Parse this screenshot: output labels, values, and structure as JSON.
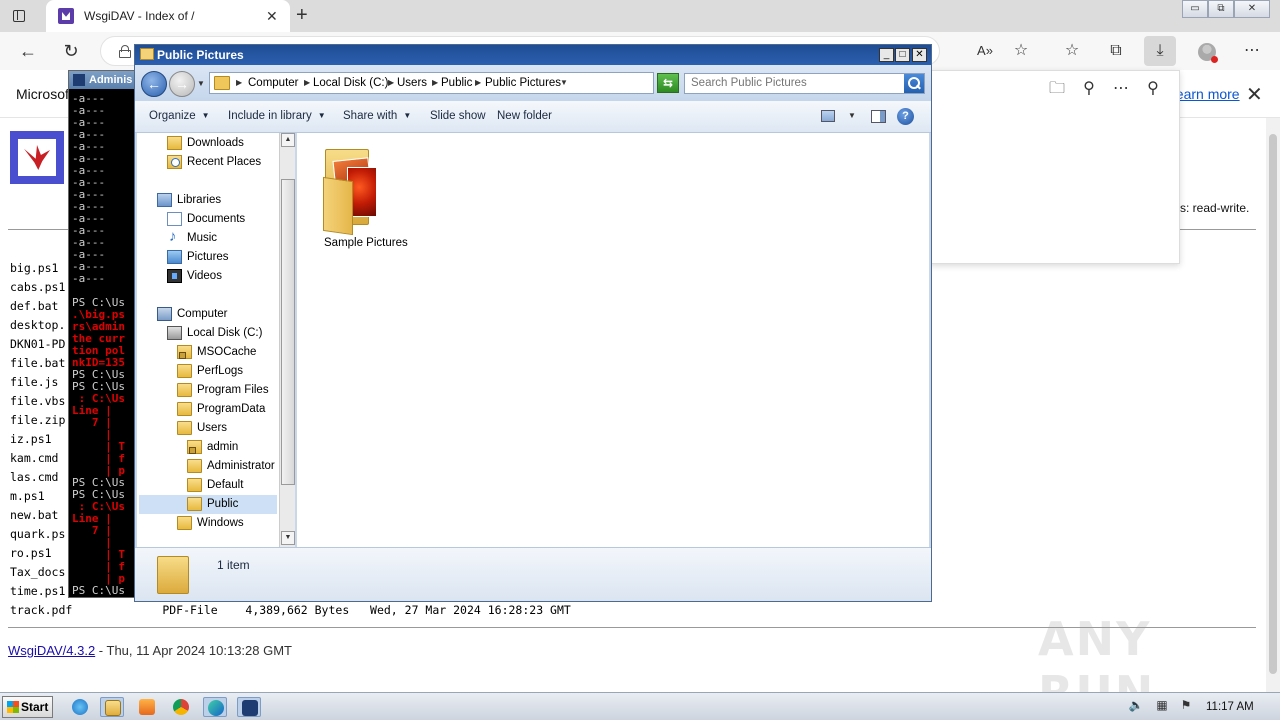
{
  "browser": {
    "tab_title": "WsgiDAV - Index of /",
    "tab_close": "✕",
    "new_tab": "+",
    "back": "←",
    "reload": "↻",
    "read_aloud": "A»",
    "icons": [
      "read-aloud-icon",
      "add-favorite-icon",
      "favorites-icon",
      "collections-icon",
      "downloads-icon",
      "profile-avatar",
      "more-menu-icon"
    ],
    "more": "⋯",
    "infobar_text": "Microsoft",
    "learn_more": "Learn more",
    "infobar_close": "✕"
  },
  "side_pane": {
    "icons": [
      "folder-icon",
      "search-icon",
      "more-icon",
      "pin-icon"
    ]
  },
  "page": {
    "access_text": "s: read-write.",
    "files": [
      "big.ps1",
      "cabs.ps1",
      "def.bat",
      "desktop.",
      "DKN01-PD",
      "file.bat",
      "file.js",
      "file.vbs",
      "file.zip",
      "iz.ps1",
      "kam.cmd",
      "las.cmd",
      "m.ps1",
      "new.bat",
      "quark.ps",
      "ro.ps1",
      "Tax_docs",
      "time.ps1"
    ],
    "track_row": "track.pdf             PDF-File    4,389,662 Bytes   Wed, 27 Mar 2024 16:28:23 GMT",
    "footer_link": "WsgiDAV/4.3.2",
    "footer_text": " - Thu, 11 Apr 2024 10:13:28 GMT",
    "watermark": "ANY RUN"
  },
  "console": {
    "title": "Adminis",
    "lines": [
      {
        "t": "-a---",
        "c": "white"
      },
      {
        "t": "-a---",
        "c": "white"
      },
      {
        "t": "-a---",
        "c": "white"
      },
      {
        "t": "-a---",
        "c": "white"
      },
      {
        "t": "-a---",
        "c": "white"
      },
      {
        "t": "-a---",
        "c": "white"
      },
      {
        "t": "-a---",
        "c": "white"
      },
      {
        "t": "-a---",
        "c": "white"
      },
      {
        "t": "-a---",
        "c": "white"
      },
      {
        "t": "-a---",
        "c": "white"
      },
      {
        "t": "-a---",
        "c": "white"
      },
      {
        "t": "-a---",
        "c": "white"
      },
      {
        "t": "-a---",
        "c": "white"
      },
      {
        "t": "-a---",
        "c": "white"
      },
      {
        "t": "-a---",
        "c": "white"
      },
      {
        "t": "-a---",
        "c": "white"
      },
      {
        "t": "",
        "c": "white"
      },
      {
        "t": "PS C:\\Us",
        "c": "white"
      },
      {
        "t": ".\\big.ps",
        "c": "red"
      },
      {
        "t": "rs\\admin",
        "c": "red"
      },
      {
        "t": "the curr",
        "c": "red"
      },
      {
        "t": "tion pol",
        "c": "red"
      },
      {
        "t": "nkID=135",
        "c": "red"
      },
      {
        "t": "PS C:\\Us",
        "c": "white"
      },
      {
        "t": "PS C:\\Us",
        "c": "white"
      },
      {
        "t": " : C:\\Us",
        "c": "red"
      },
      {
        "t": "Line |",
        "c": "red"
      },
      {
        "t": "   7 |",
        "c": "red"
      },
      {
        "t": "     |",
        "c": "red"
      },
      {
        "t": "     | T",
        "c": "red"
      },
      {
        "t": "     | f",
        "c": "red"
      },
      {
        "t": "     | p",
        "c": "red"
      },
      {
        "t": "PS C:\\Us",
        "c": "white"
      },
      {
        "t": "PS C:\\Us",
        "c": "white"
      },
      {
        "t": " : C:\\Us",
        "c": "red"
      },
      {
        "t": "Line |",
        "c": "red"
      },
      {
        "t": "   7 |",
        "c": "red"
      },
      {
        "t": "     |",
        "c": "red"
      },
      {
        "t": "     | T",
        "c": "red"
      },
      {
        "t": "     | f",
        "c": "red"
      },
      {
        "t": "     | p",
        "c": "red"
      },
      {
        "t": "PS C:\\Us",
        "c": "white"
      }
    ]
  },
  "explorer": {
    "title": "Public Pictures",
    "minimize": "_",
    "maximize": "□",
    "close": "✕",
    "breadcrumbs": [
      "Computer",
      "Local Disk (C:)",
      "Users",
      "Public",
      "Public Pictures"
    ],
    "search_placeholder": "Search Public Pictures",
    "toolbar": {
      "organize": "Organize",
      "include_in_library": "Include in library",
      "share_with": "Share with",
      "slide_show": "Slide show",
      "new_folder": "New folder",
      "help": "?"
    },
    "nav_items": [
      {
        "label": "Downloads",
        "indent": 1,
        "icon": "downloads"
      },
      {
        "label": "Recent Places",
        "indent": 1,
        "icon": "recent"
      },
      {
        "label": "",
        "indent": 0,
        "icon": "none"
      },
      {
        "label": "Libraries",
        "indent": 0,
        "icon": "lib"
      },
      {
        "label": "Documents",
        "indent": 1,
        "icon": "doc"
      },
      {
        "label": "Music",
        "indent": 1,
        "icon": "music"
      },
      {
        "label": "Pictures",
        "indent": 1,
        "icon": "pics"
      },
      {
        "label": "Videos",
        "indent": 1,
        "icon": "video"
      },
      {
        "label": "",
        "indent": 0,
        "icon": "none"
      },
      {
        "label": "Computer",
        "indent": 0,
        "icon": "computer"
      },
      {
        "label": "Local Disk (C:)",
        "indent": 1,
        "icon": "disk"
      },
      {
        "label": "MSOCache",
        "indent": 2,
        "icon": "folder-lock"
      },
      {
        "label": "PerfLogs",
        "indent": 2,
        "icon": "folder"
      },
      {
        "label": "Program Files",
        "indent": 2,
        "icon": "folder"
      },
      {
        "label": "ProgramData",
        "indent": 2,
        "icon": "folder"
      },
      {
        "label": "Users",
        "indent": 2,
        "icon": "folder"
      },
      {
        "label": "admin",
        "indent": 3,
        "icon": "folder-lock"
      },
      {
        "label": "Administrator",
        "indent": 3,
        "icon": "folder"
      },
      {
        "label": "Default",
        "indent": 3,
        "icon": "folder"
      },
      {
        "label": "Public",
        "indent": 3,
        "icon": "folder",
        "selected": true
      },
      {
        "label": "Windows",
        "indent": 2,
        "icon": "folder"
      }
    ],
    "content_items": [
      {
        "label": "Sample Pictures"
      }
    ],
    "status": "1 item"
  },
  "taskbar": {
    "start": "Start",
    "apps": [
      "ie-icon",
      "explorer-icon",
      "media-player-icon",
      "chrome-icon",
      "edge-icon",
      "powershell-icon"
    ],
    "clock": "11:17 AM"
  }
}
